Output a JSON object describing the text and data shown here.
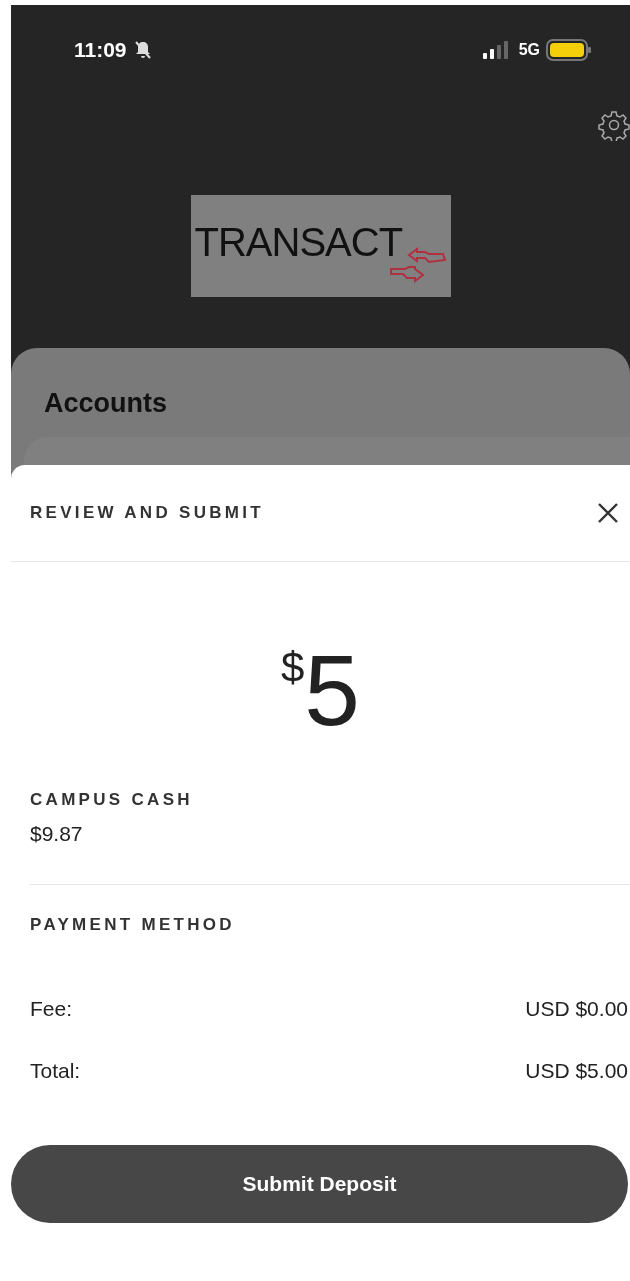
{
  "status_bar": {
    "time": "11:09",
    "network": "5G"
  },
  "header": {
    "logo": "TRANSACT"
  },
  "background_card": {
    "title": "Accounts"
  },
  "sheet": {
    "title": "REVIEW AND SUBMIT",
    "amount": {
      "currency": "$",
      "value": "5"
    },
    "account": {
      "label": "CAMPUS CASH",
      "balance": "$9.87"
    },
    "payment_method": {
      "label": "PAYMENT METHOD"
    },
    "summary": [
      {
        "label": "Fee:",
        "value": "USD $0.00"
      },
      {
        "label": "Total:",
        "value": "USD $5.00"
      }
    ],
    "submit_button": "Submit Deposit"
  }
}
